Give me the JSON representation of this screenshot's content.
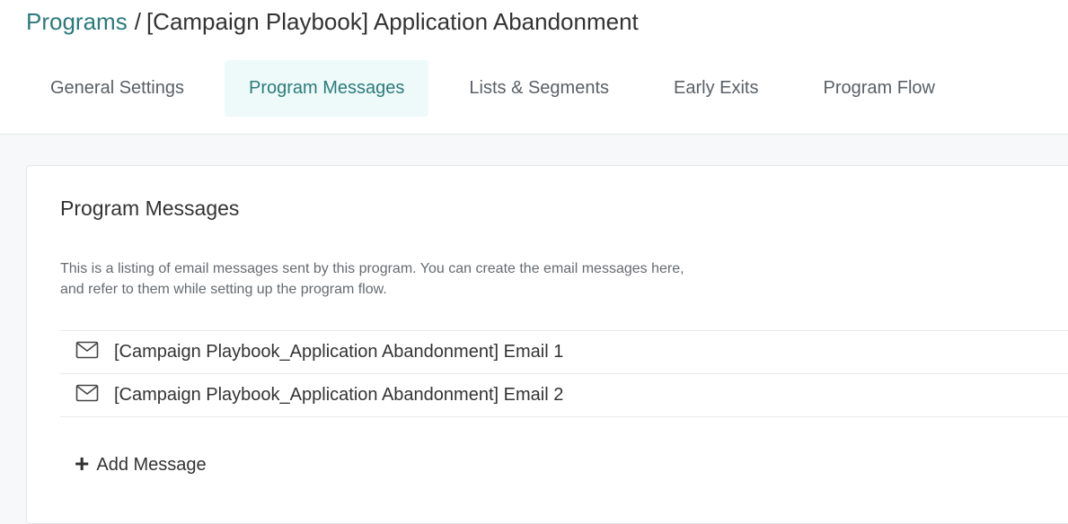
{
  "breadcrumb": {
    "parent": "Programs",
    "separator": "/",
    "current": "[Campaign Playbook] Application Abandonment"
  },
  "tabs": [
    {
      "label": "General Settings",
      "active": false
    },
    {
      "label": "Program Messages",
      "active": true
    },
    {
      "label": "Lists & Segments",
      "active": false
    },
    {
      "label": "Early Exits",
      "active": false
    },
    {
      "label": "Program Flow",
      "active": false
    }
  ],
  "panel": {
    "title": "Program Messages",
    "description": "This is a listing of email messages sent by this program. You can create the email messages here, and refer to them while setting up the program flow."
  },
  "messages": [
    {
      "icon": "envelope-icon",
      "name": "[Campaign Playbook_Application Abandonment] Email 1"
    },
    {
      "icon": "envelope-icon",
      "name": "[Campaign Playbook_Application Abandonment] Email 2"
    }
  ],
  "add_message": {
    "icon": "plus-icon",
    "label": "Add Message"
  },
  "colors": {
    "accent": "#2c7a7b",
    "active_tab_bg": "#eefaf9",
    "page_bg": "#f7f8f9"
  }
}
